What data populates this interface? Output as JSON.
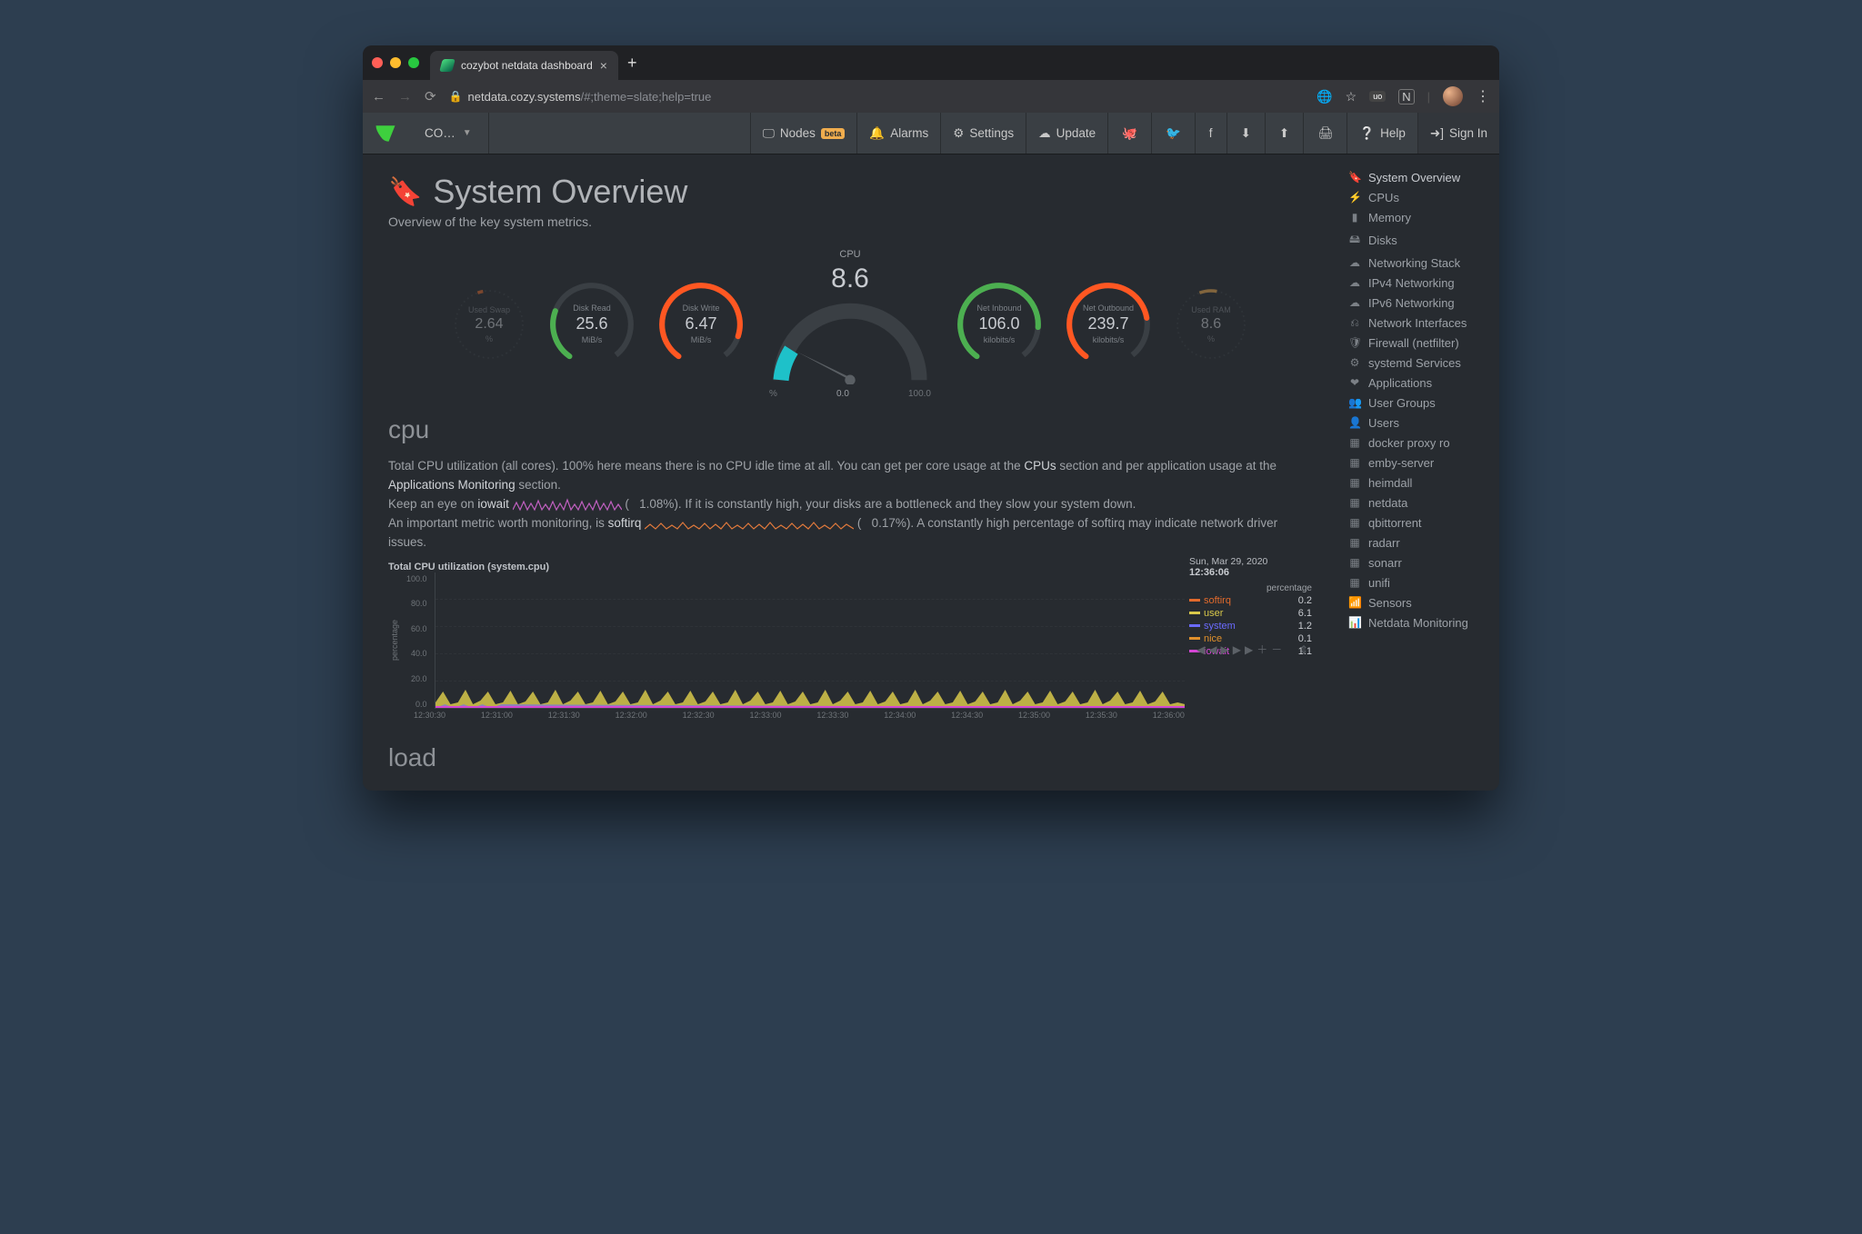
{
  "browser": {
    "tab_title": "cozybot netdata dashboard",
    "host": "netdata.cozy.systems",
    "path": "/#;theme=slate;help=true"
  },
  "toolbar": {
    "host_dropdown": "CO…",
    "nodes": "Nodes",
    "beta": "beta",
    "alarms": "Alarms",
    "settings": "Settings",
    "update": "Update",
    "help": "Help",
    "signin": "Sign In"
  },
  "page": {
    "title": "System Overview",
    "subtitle": "Overview of the key system metrics."
  },
  "gauges": {
    "used_swap": {
      "label": "Used Swap",
      "value": "2.64",
      "unit": "%"
    },
    "disk_read": {
      "label": "Disk Read",
      "value": "25.6",
      "unit": "MiB/s"
    },
    "disk_write": {
      "label": "Disk Write",
      "value": "6.47",
      "unit": "MiB/s"
    },
    "cpu": {
      "label": "CPU",
      "value": "8.6",
      "min": "0.0",
      "max": "100.0",
      "minlbl": "%"
    },
    "net_in": {
      "label": "Net Inbound",
      "value": "106.0",
      "unit": "kilobits/s"
    },
    "net_out": {
      "label": "Net Outbound",
      "value": "239.7",
      "unit": "kilobits/s"
    },
    "used_ram": {
      "label": "Used RAM",
      "value": "8.6",
      "unit": "%"
    }
  },
  "cpu_section": {
    "title": "cpu",
    "p1a": "Total CPU utilization (all cores). 100% here means there is no CPU idle time at all. You can get per core usage at the ",
    "p1_link1": "CPUs",
    "p1b": " section and per application usage at the ",
    "p1_link2": "Applications Monitoring",
    "p1c": " section.",
    "p2a": "Keep an eye on ",
    "p2_bold": "iowait",
    "p2b": " (",
    "p2_val": "1.08%",
    "p2c": "). If it is constantly high, your disks are a bottleneck and they slow your system down.",
    "p3a": "An important metric worth monitoring, is ",
    "p3_bold": "softirq",
    "p3b": " (",
    "p3_val": "0.17%",
    "p3c": "). A constantly high percentage of softirq may indicate network driver issues."
  },
  "chart": {
    "title": "Total CPU utilization (system.cpu)",
    "ylabel": "percentage",
    "timestamp_date": "Sun, Mar 29, 2020",
    "timestamp_time": "12:36:06",
    "unit_label": "percentage",
    "legend": [
      {
        "name": "softirq",
        "value": "0.2",
        "color": "#e26a2c"
      },
      {
        "name": "user",
        "value": "6.1",
        "color": "#d8c84a"
      },
      {
        "name": "system",
        "value": "1.2",
        "color": "#6b6bff"
      },
      {
        "name": "nice",
        "value": "0.1",
        "color": "#e0902c"
      },
      {
        "name": "iowait",
        "value": "1.1",
        "color": "#d445d4"
      }
    ],
    "xticks": [
      "12:30:30",
      "12:31:00",
      "12:31:30",
      "12:32:00",
      "12:32:30",
      "12:33:00",
      "12:33:30",
      "12:34:00",
      "12:34:30",
      "12:35:00",
      "12:35:30",
      "12:36:00"
    ],
    "yticks": [
      "100.0",
      "80.0",
      "60.0",
      "40.0",
      "20.0",
      "0.0"
    ]
  },
  "chart_data": {
    "type": "line",
    "title": "Total CPU utilization (system.cpu)",
    "xlabel": "",
    "ylabel": "percentage",
    "ylim": [
      0,
      100
    ],
    "categories": [
      "12:30:30",
      "12:31:00",
      "12:31:30",
      "12:32:00",
      "12:32:30",
      "12:33:00",
      "12:33:30",
      "12:34:00",
      "12:34:30",
      "12:35:00",
      "12:35:30",
      "12:36:00"
    ],
    "series": [
      {
        "name": "softirq",
        "color": "#e26a2c",
        "values": [
          0.2,
          0.2,
          0.2,
          0.2,
          0.2,
          0.2,
          0.2,
          0.2,
          0.2,
          0.2,
          0.2,
          0.2
        ]
      },
      {
        "name": "user",
        "color": "#d8c84a",
        "values": [
          6,
          6,
          6,
          6,
          6,
          6,
          6,
          6,
          6,
          6,
          6,
          6.1
        ]
      },
      {
        "name": "system",
        "color": "#6b6bff",
        "values": [
          1.2,
          1.2,
          1.2,
          1.2,
          1.2,
          1.2,
          1.2,
          1.2,
          1.2,
          1.2,
          1.2,
          1.2
        ]
      },
      {
        "name": "nice",
        "color": "#e0902c",
        "values": [
          0.1,
          0.1,
          0.1,
          0.1,
          0.1,
          0.1,
          0.1,
          0.1,
          0.1,
          0.1,
          0.1,
          0.1
        ]
      },
      {
        "name": "iowait",
        "color": "#d445d4",
        "values": [
          1.1,
          1.1,
          1.1,
          1.1,
          1.1,
          1.1,
          1.1,
          1.1,
          1.1,
          1.1,
          1.1,
          1.1
        ]
      }
    ]
  },
  "load_section": {
    "title": "load"
  },
  "sidebar": {
    "items": [
      {
        "icon": "bookmark",
        "label": "System Overview"
      },
      {
        "icon": "bolt",
        "label": "CPUs"
      },
      {
        "icon": "chip",
        "label": "Memory"
      },
      {
        "icon": "disk",
        "label": "Disks"
      },
      {
        "icon": "cloud",
        "label": "Networking Stack"
      },
      {
        "icon": "cloud",
        "label": "IPv4 Networking"
      },
      {
        "icon": "cloud",
        "label": "IPv6 Networking"
      },
      {
        "icon": "sitemap",
        "label": "Network Interfaces"
      },
      {
        "icon": "shield",
        "label": "Firewall (netfilter)"
      },
      {
        "icon": "gears",
        "label": "systemd Services"
      },
      {
        "icon": "heart",
        "label": "Applications"
      },
      {
        "icon": "users",
        "label": "User Groups"
      },
      {
        "icon": "user",
        "label": "Users"
      },
      {
        "icon": "grid",
        "label": "docker proxy ro"
      },
      {
        "icon": "grid",
        "label": "emby-server"
      },
      {
        "icon": "grid",
        "label": "heimdall"
      },
      {
        "icon": "grid",
        "label": "netdata"
      },
      {
        "icon": "grid",
        "label": "qbittorrent"
      },
      {
        "icon": "grid",
        "label": "radarr"
      },
      {
        "icon": "grid",
        "label": "sonarr"
      },
      {
        "icon": "grid",
        "label": "unifi"
      },
      {
        "icon": "signal",
        "label": "Sensors"
      },
      {
        "icon": "bars",
        "label": "Netdata Monitoring"
      }
    ]
  }
}
